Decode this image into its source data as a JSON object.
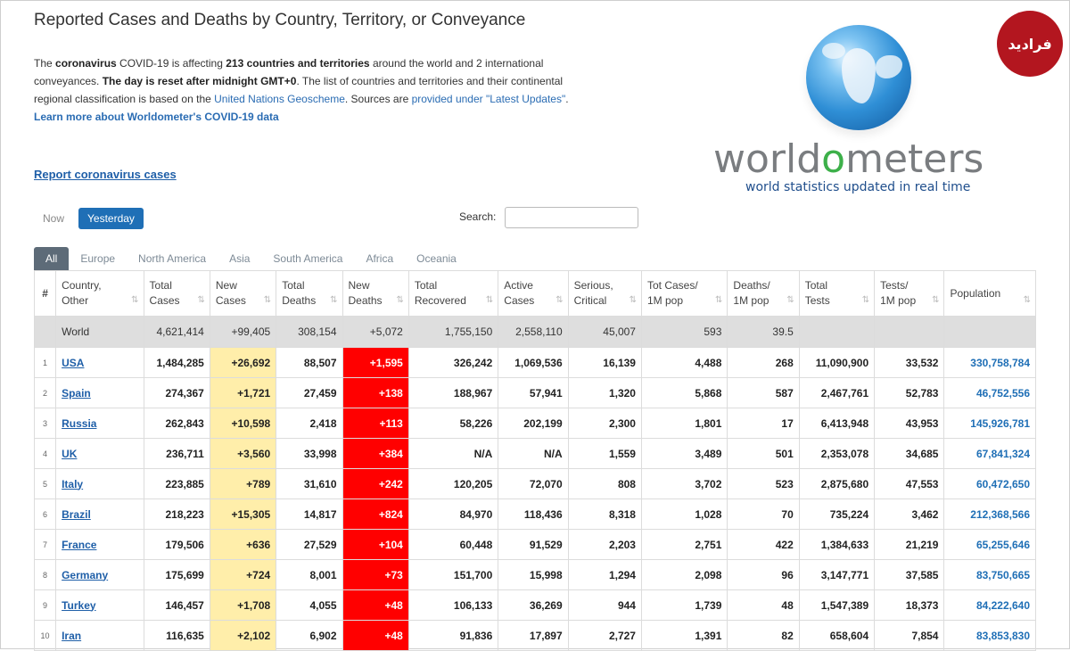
{
  "page_title": "Reported Cases and Deaths by Country, Territory, or Conveyance",
  "intro": {
    "p1": "The ",
    "b1": "coronavirus",
    "p2": " COVID-19 is affecting ",
    "b2": "213 countries and territories",
    "p3": " around the world and 2 international conveyances. ",
    "b3": "The day is reset after midnight GMT+0",
    "p4": ". The list of countries and territories and their continental regional classification is based on the ",
    "link1": "United Nations Geoscheme",
    "p5": ". Sources are ",
    "link2": "provided under \"Latest Updates\"",
    "p6": ". ",
    "link3": "Learn more about Worldometer's COVID-19 data"
  },
  "report_link": "Report coronavirus cases",
  "logo": {
    "word_a": "world",
    "word_o": "o",
    "word_b": "meters",
    "tagline": "world statistics updated in real time"
  },
  "badge": "فرادید",
  "toggle": {
    "now": "Now",
    "yesterday": "Yesterday"
  },
  "search": {
    "label": "Search:",
    "value": "",
    "placeholder": ""
  },
  "tabs": [
    "All",
    "Europe",
    "North America",
    "Asia",
    "South America",
    "Africa",
    "Oceania"
  ],
  "table": {
    "headers": [
      [
        "#",
        ""
      ],
      [
        "Country,",
        "Other"
      ],
      [
        "Total",
        "Cases"
      ],
      [
        "New",
        "Cases"
      ],
      [
        "Total",
        "Deaths"
      ],
      [
        "New",
        "Deaths"
      ],
      [
        "Total",
        "Recovered"
      ],
      [
        "Active",
        "Cases"
      ],
      [
        "Serious,",
        "Critical"
      ],
      [
        "Tot Cases/",
        "1M pop"
      ],
      [
        "Deaths/",
        "1M pop"
      ],
      [
        "Total",
        "Tests"
      ],
      [
        "Tests/",
        "1M pop"
      ],
      [
        "Population",
        ""
      ]
    ],
    "world": [
      "",
      "World",
      "4,621,414",
      "+99,405",
      "308,154",
      "+5,072",
      "1,755,150",
      "2,558,110",
      "45,007",
      "593",
      "39.5",
      "",
      "",
      ""
    ],
    "rows": [
      [
        "1",
        "USA",
        "1,484,285",
        "+26,692",
        "88,507",
        "+1,595",
        "326,242",
        "1,069,536",
        "16,139",
        "4,488",
        "268",
        "11,090,900",
        "33,532",
        "330,758,784"
      ],
      [
        "2",
        "Spain",
        "274,367",
        "+1,721",
        "27,459",
        "+138",
        "188,967",
        "57,941",
        "1,320",
        "5,868",
        "587",
        "2,467,761",
        "52,783",
        "46,752,556"
      ],
      [
        "3",
        "Russia",
        "262,843",
        "+10,598",
        "2,418",
        "+113",
        "58,226",
        "202,199",
        "2,300",
        "1,801",
        "17",
        "6,413,948",
        "43,953",
        "145,926,781"
      ],
      [
        "4",
        "UK",
        "236,711",
        "+3,560",
        "33,998",
        "+384",
        "N/A",
        "N/A",
        "1,559",
        "3,489",
        "501",
        "2,353,078",
        "34,685",
        "67,841,324"
      ],
      [
        "5",
        "Italy",
        "223,885",
        "+789",
        "31,610",
        "+242",
        "120,205",
        "72,070",
        "808",
        "3,702",
        "523",
        "2,875,680",
        "47,553",
        "60,472,650"
      ],
      [
        "6",
        "Brazil",
        "218,223",
        "+15,305",
        "14,817",
        "+824",
        "84,970",
        "118,436",
        "8,318",
        "1,028",
        "70",
        "735,224",
        "3,462",
        "212,368,566"
      ],
      [
        "7",
        "France",
        "179,506",
        "+636",
        "27,529",
        "+104",
        "60,448",
        "91,529",
        "2,203",
        "2,751",
        "422",
        "1,384,633",
        "21,219",
        "65,255,646"
      ],
      [
        "8",
        "Germany",
        "175,699",
        "+724",
        "8,001",
        "+73",
        "151,700",
        "15,998",
        "1,294",
        "2,098",
        "96",
        "3,147,771",
        "37,585",
        "83,750,665"
      ],
      [
        "9",
        "Turkey",
        "146,457",
        "+1,708",
        "4,055",
        "+48",
        "106,133",
        "36,269",
        "944",
        "1,739",
        "48",
        "1,547,389",
        "18,373",
        "84,222,640"
      ],
      [
        "10",
        "Iran",
        "116,635",
        "+2,102",
        "6,902",
        "+48",
        "91,836",
        "17,897",
        "2,727",
        "1,391",
        "82",
        "658,604",
        "7,854",
        "83,853,830"
      ]
    ]
  },
  "colors": {
    "new_cases_bg": "#ffeeaa",
    "new_deaths_bg": "#ff0000",
    "link": "#1f5fa8",
    "active_tab": "#5d6b78",
    "toggle_active": "#1f6fb6"
  },
  "icons": {
    "sort": "sort-arrows-icon",
    "globe": "globe-icon"
  }
}
